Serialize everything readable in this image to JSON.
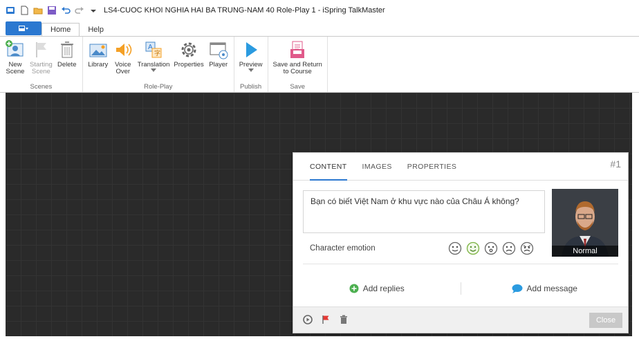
{
  "window": {
    "title": "LS4-CUOC KHOI NGHIA HAI BA TRUNG-NAM 40 Role-Play 1 - iSpring TalkMaster"
  },
  "ribbon_tabs": {
    "home": "Home",
    "help": "Help"
  },
  "ribbon": {
    "scenes": {
      "label": "Scenes",
      "new_scene": "New\nScene",
      "starting_scene": "Starting\nScene",
      "delete": "Delete"
    },
    "roleplay": {
      "label": "Role-Play",
      "library": "Library",
      "voice_over": "Voice\nOver",
      "translation": "Translation",
      "properties": "Properties",
      "player": "Player"
    },
    "publish": {
      "label": "Publish",
      "preview": "Preview"
    },
    "save": {
      "label": "Save",
      "save_return": "Save and Return\nto Course"
    }
  },
  "panel": {
    "tabs": {
      "content": "CONTENT",
      "images": "IMAGES",
      "properties": "PROPERTIES"
    },
    "scene_number": "#1",
    "message": "Bạn có biết Việt Nam ở khu vực nào của Châu Á không?",
    "character_state": "Normal",
    "emotion_label": "Character emotion",
    "add_replies": "Add replies",
    "add_message": "Add message",
    "close": "Close"
  },
  "colors": {
    "accent": "#2b78d0",
    "canvas": "#2a2a2a",
    "replies_icon": "#4caf50",
    "message_icon": "#2b9be0",
    "flag": "#e53935"
  }
}
